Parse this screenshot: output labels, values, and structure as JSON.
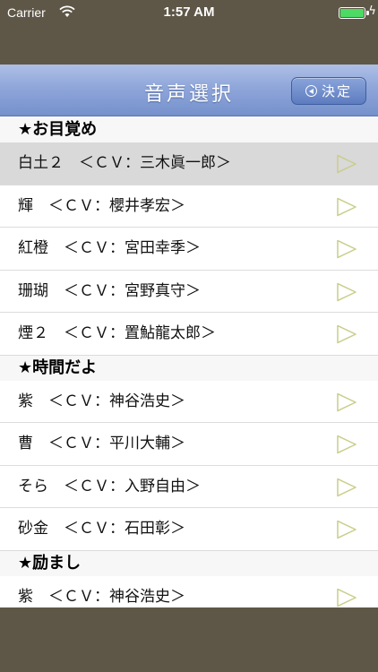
{
  "status_bar": {
    "carrier": "Carrier",
    "time": "1:57 AM"
  },
  "navbar": {
    "title": "音声選択",
    "confirm_label": "決定"
  },
  "sections": [
    {
      "header": "★お目覚め",
      "rows": [
        {
          "label": "白土２　＜ＣＶ：三木眞一郎＞",
          "selected": true
        },
        {
          "label": "輝　＜ＣＶ：櫻井孝宏＞"
        },
        {
          "label": "紅橙　＜ＣＶ：宮田幸季＞"
        },
        {
          "label": "珊瑚　＜ＣＶ：宮野真守＞"
        },
        {
          "label": "煙２　＜ＣＶ：置鮎龍太郎＞"
        }
      ]
    },
    {
      "header": "★時間だよ",
      "rows": [
        {
          "label": "紫　＜ＣＶ：神谷浩史＞"
        },
        {
          "label": "曹　＜ＣＶ：平川大輔＞"
        },
        {
          "label": "そら　＜ＣＶ：入野自由＞"
        },
        {
          "label": "砂金　＜ＣＶ：石田彰＞"
        }
      ]
    },
    {
      "header": "★励まし",
      "rows": [
        {
          "label": "紫　＜ＣＶ：神谷浩史＞"
        }
      ]
    }
  ],
  "colors": {
    "background": "#5e5747",
    "navbar": "#8fa6da",
    "selected_row": "#d9d9d9",
    "battery": "#4cd964"
  }
}
